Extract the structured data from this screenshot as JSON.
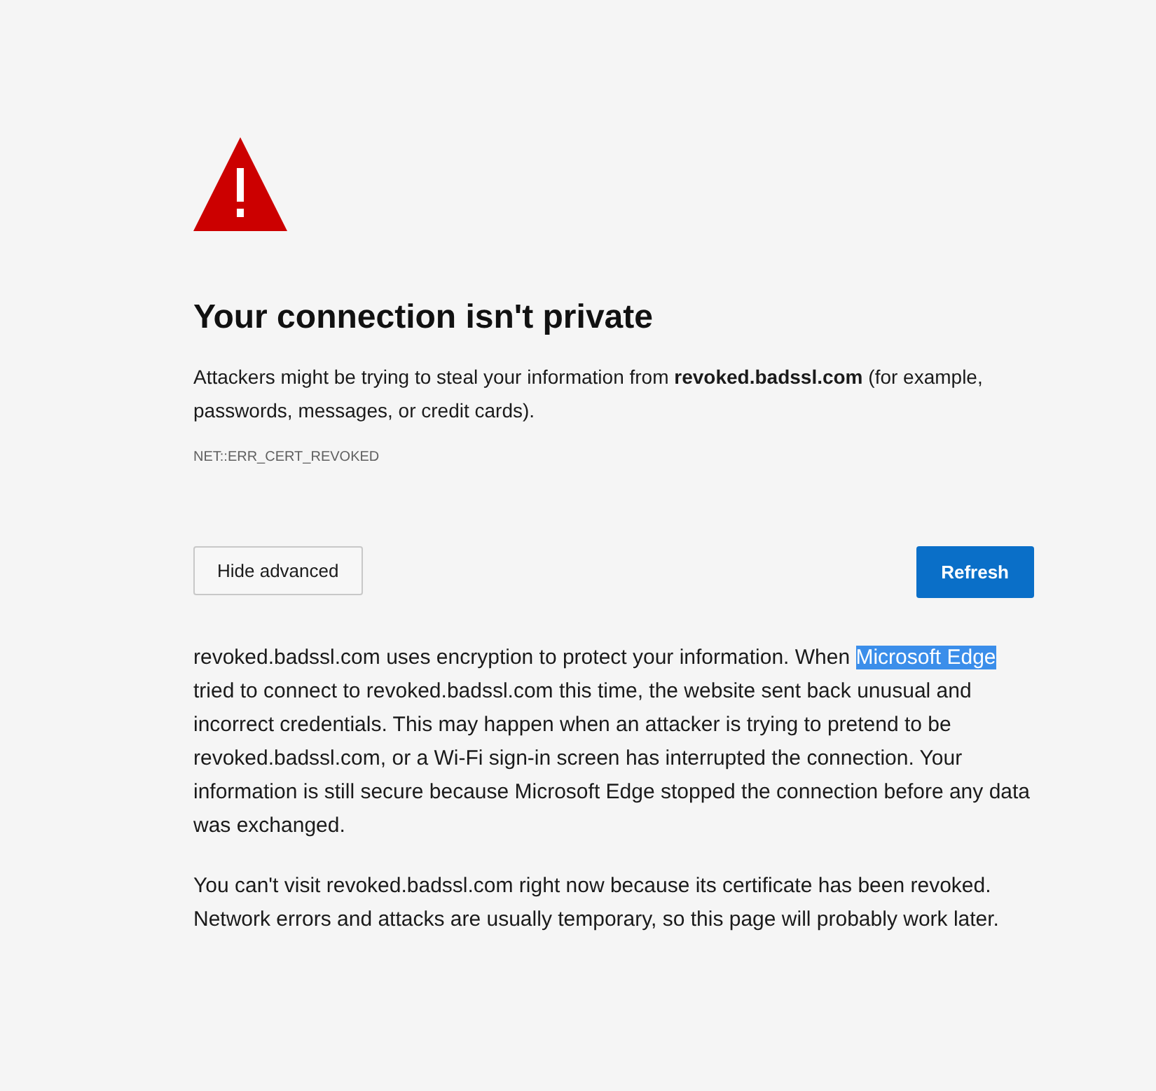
{
  "heading": "Your connection isn't private",
  "summary": "Attackers might be trying to steal your information from **revoked.badssl.com** (for example, passwords, messages, or credit cards).",
  "error_code": "NET::ERR_CERT_REVOKED",
  "buttons": [
    {
      "label": "Hide advanced",
      "kind": "secondary"
    },
    {
      "label": "Refresh",
      "kind": "primary"
    }
  ],
  "details": [
    {
      "segments": [
        {
          "text": "revoked.badssl.com uses encryption to protect your information. When ",
          "highlighted": false
        },
        {
          "text": "Microsoft Edge",
          "highlighted": true
        },
        {
          "text": " tried to connect to revoked.badssl.com this time, the website sent back unusual and incorrect credentials. This may happen when an attacker is trying to pretend to be revoked.badssl.com, or a Wi-Fi sign-in screen has interrupted the connection. Your information is still secure because Microsoft Edge stopped the connection before any data was exchanged.",
          "highlighted": false
        }
      ]
    },
    {
      "segments": [
        {
          "text": "You can't visit revoked.badssl.com right now because its certificate has been revoked. Network errors and attacks are usually temporary, so this page will probably work later.",
          "highlighted": false
        }
      ]
    }
  ]
}
